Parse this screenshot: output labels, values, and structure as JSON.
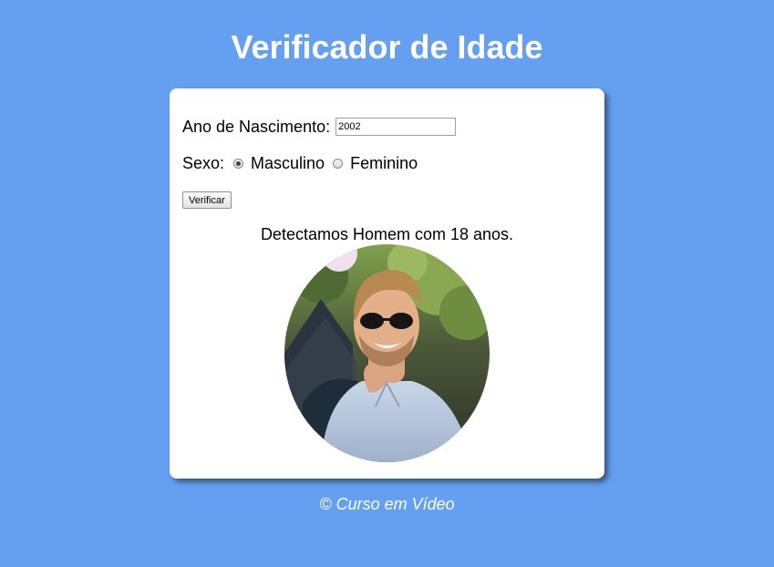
{
  "header": {
    "title": "Verificador de Idade"
  },
  "form": {
    "year_label": "Ano de Nascimento:",
    "year_value": "2002",
    "sex_label": "Sexo:",
    "options": [
      {
        "label": "Masculino",
        "checked": true
      },
      {
        "label": "Feminino",
        "checked": false
      }
    ],
    "verify_label": "Verificar"
  },
  "result": {
    "message": "Detectamos Homem com 18 anos.",
    "image_alt": "man-photo"
  },
  "footer": {
    "text": "© Curso em Vídeo"
  },
  "colors": {
    "background": "#649ff0",
    "card": "#ffffff"
  }
}
